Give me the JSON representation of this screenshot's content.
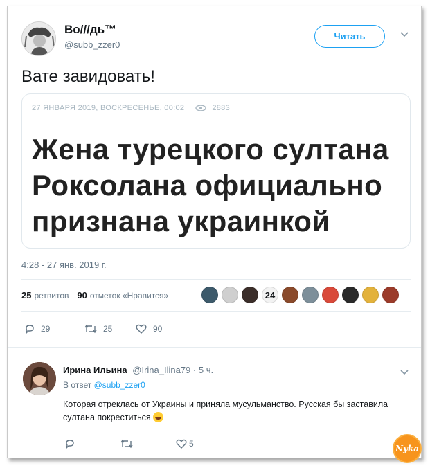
{
  "tweet": {
    "author_name": "Во///дь™",
    "author_handle": "@subb_zzer0",
    "follow_label": "Читать",
    "text": "Вате завидовать!",
    "card": {
      "meta_date": "27 ЯНВАРЯ 2019, ВОСКРЕСЕНЬЕ, 00:02",
      "views": "2883",
      "headline": "Жена турецкого султана\nРоксолана официально\nпризнана украинкой"
    },
    "timestamp": "4:28 - 27 янв. 2019 г.",
    "stats": {
      "retweets_count": "25",
      "retweets_label": "ретвитов",
      "likes_count": "90",
      "likes_label": "отметок «Нравится»"
    },
    "liker_avatars": [
      "#3d5a6b",
      "#cfcfcf",
      "#3b2e2a",
      "#f2f2f2",
      "#8a4a2b",
      "#7d8f9a",
      "#d94a3a",
      "#2a2a2a",
      "#e3b23c",
      "#9b3b2a"
    ],
    "liker_badge_text": "24",
    "actions": {
      "replies": "29",
      "retweets": "25",
      "likes": "90"
    }
  },
  "reply": {
    "author_name": "Ирина Ильина",
    "author_handle": "@Irina_Ilina79",
    "time": "· 5 ч.",
    "reply_to_prefix": "В ответ",
    "reply_to_handle": "@subb_zzer0",
    "text": "Которая отреклась от Украины и приняла мусульманство. Русская бы заставила султана покреститься",
    "actions": {
      "replies": "",
      "retweets": "",
      "likes": "5"
    }
  },
  "watermark": "Nyka",
  "colors": {
    "accent": "#1da1f2",
    "muted": "#657786",
    "divider": "#e6ecf0"
  }
}
